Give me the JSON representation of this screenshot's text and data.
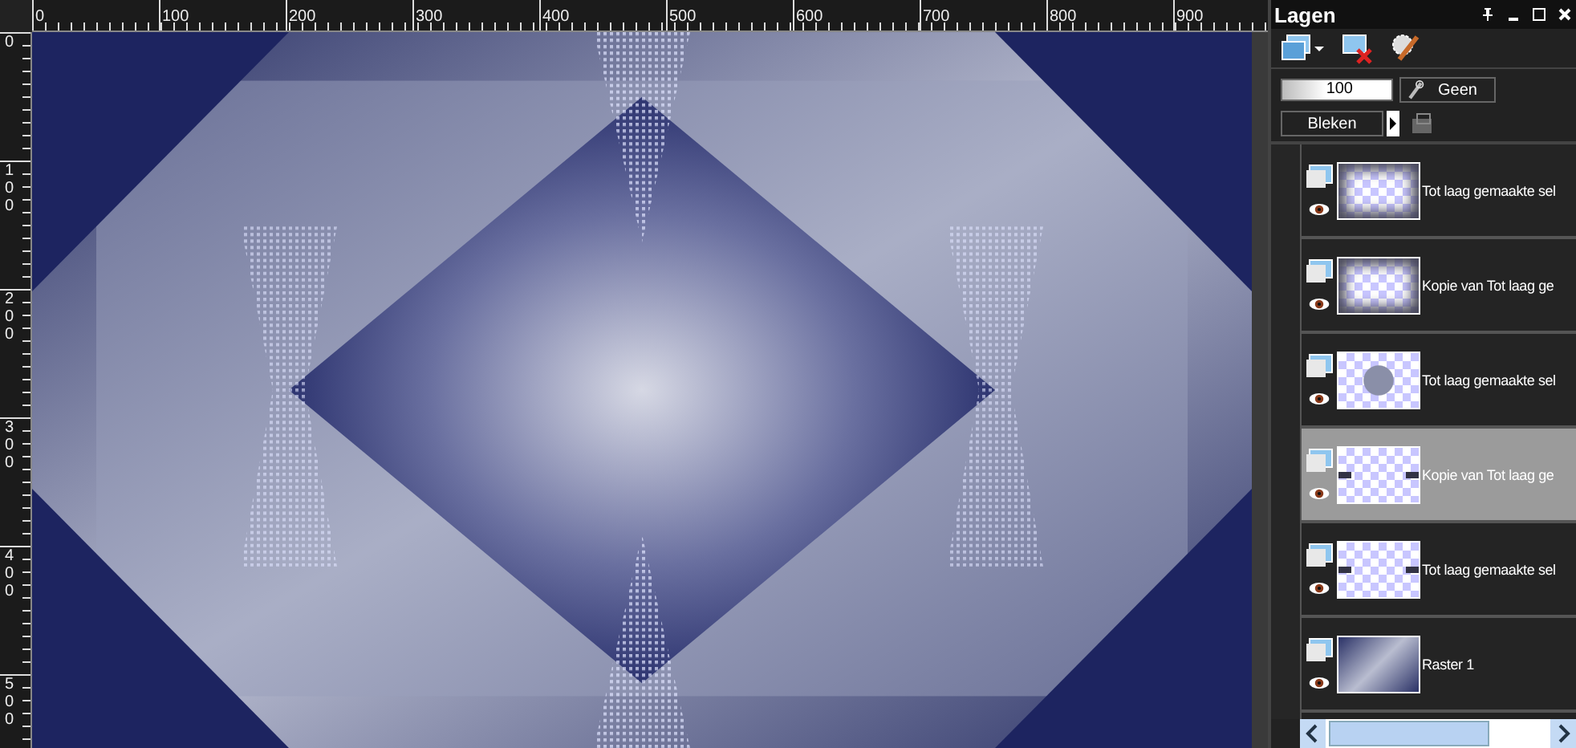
{
  "rulers": {
    "horizontal_labels": [
      "0",
      "100",
      "200",
      "300",
      "400",
      "500",
      "600",
      "700",
      "800",
      "900"
    ],
    "vertical_labels": [
      "0",
      "100",
      "200",
      "300",
      "400",
      "500"
    ]
  },
  "layers_panel": {
    "title": "Lagen",
    "opacity": "100",
    "link_button": "Geen",
    "blend_mode": "Bleken",
    "layers": [
      {
        "name": "Tot laag gemaakte sel",
        "selected": false
      },
      {
        "name": "Kopie van Tot laag ge",
        "selected": false
      },
      {
        "name": "Tot laag gemaakte sel",
        "selected": false
      },
      {
        "name": "Kopie van Tot laag ge",
        "selected": true
      },
      {
        "name": "Tot laag gemaakte sel",
        "selected": false
      },
      {
        "name": "Raster 1",
        "selected": false
      }
    ]
  }
}
